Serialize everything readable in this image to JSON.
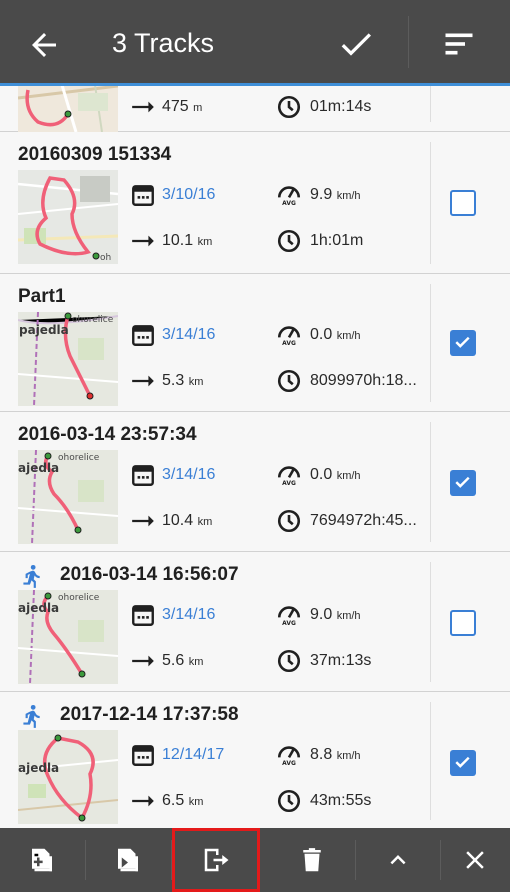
{
  "header": {
    "title": "3 Tracks",
    "icons": [
      "arrow-left-icon",
      "check-icon",
      "sort-icon"
    ]
  },
  "tracks": [
    {
      "name": "",
      "date": "",
      "speed": "",
      "speed_unit": "",
      "distance": "475",
      "distance_unit": "m",
      "duration": "01m:14s",
      "checked": null,
      "activity": null
    },
    {
      "name": "20160309 151334",
      "date": "3/10/16",
      "speed": "9.9",
      "speed_unit": "km/h",
      "distance": "10.1",
      "distance_unit": "km",
      "duration": "1h:01m",
      "checked": false,
      "activity": null
    },
    {
      "name": "Part1",
      "date": "3/14/16",
      "speed": "0.0",
      "speed_unit": "km/h",
      "distance": "5.3",
      "distance_unit": "km",
      "duration": "8099970h:18...",
      "checked": true,
      "activity": null
    },
    {
      "name": "2016-03-14 23:57:34",
      "date": "3/14/16",
      "speed": "0.0",
      "speed_unit": "km/h",
      "distance": "10.4",
      "distance_unit": "km",
      "duration": "7694972h:45...",
      "checked": true,
      "activity": null
    },
    {
      "name": "2016-03-14 16:56:07",
      "date": "3/14/16",
      "speed": "9.0",
      "speed_unit": "km/h",
      "distance": "5.6",
      "distance_unit": "km",
      "duration": "37m:13s",
      "checked": false,
      "activity": "running-icon"
    },
    {
      "name": "2017-12-14 17:37:58",
      "date": "12/14/17",
      "speed": "8.8",
      "speed_unit": "km/h",
      "distance": "6.5",
      "distance_unit": "km",
      "duration": "43m:55s",
      "checked": true,
      "activity": "running-icon"
    }
  ],
  "map_labels": {
    "oh": "oh",
    "ohorelice": "ohorelice",
    "pajedla": "pajedla",
    "ajedla": "ajedla"
  },
  "bottom_bar": {
    "buttons": [
      "add-to-folder-icon",
      "move-to-folder-icon",
      "export-icon",
      "delete-icon",
      "chevron-up-icon",
      "close-icon"
    ],
    "highlighted": "export-icon"
  },
  "colors": {
    "toolbar": "#4a4a4a",
    "accent": "#3a7fd5",
    "track_line": "#f06078",
    "highlight": "#e41a1a"
  }
}
